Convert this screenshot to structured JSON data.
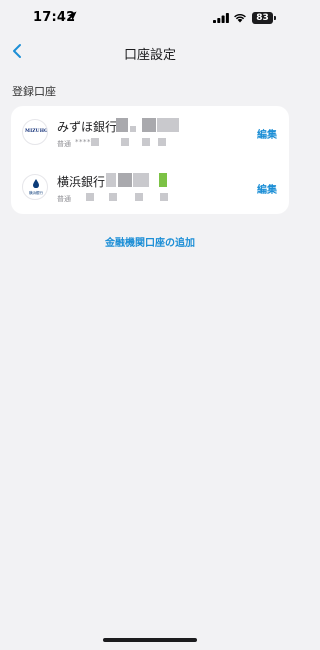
{
  "status_bar": {
    "time": "17:42",
    "battery": "83",
    "icons": [
      "location-arrow-icon",
      "signal-icon",
      "wifi-icon",
      "battery-icon"
    ]
  },
  "nav": {
    "title": "口座設定",
    "back_icon": "chevron-left-icon"
  },
  "section": {
    "label": "登録口座"
  },
  "accounts": [
    {
      "bank_name": "みずほ銀行",
      "logo_text": "MIZUHO",
      "account_type": "普通",
      "account_mask": "****",
      "edit_label": "編集"
    },
    {
      "bank_name": "横浜銀行",
      "logo_text": "横浜銀行",
      "account_type": "普通",
      "edit_label": "編集"
    }
  ],
  "add_link": "金融機関口座の追加",
  "colors": {
    "background": "#f2f2f4",
    "card": "#ffffff",
    "accent": "#1d8fd6",
    "text_secondary": "#8e8e93"
  }
}
